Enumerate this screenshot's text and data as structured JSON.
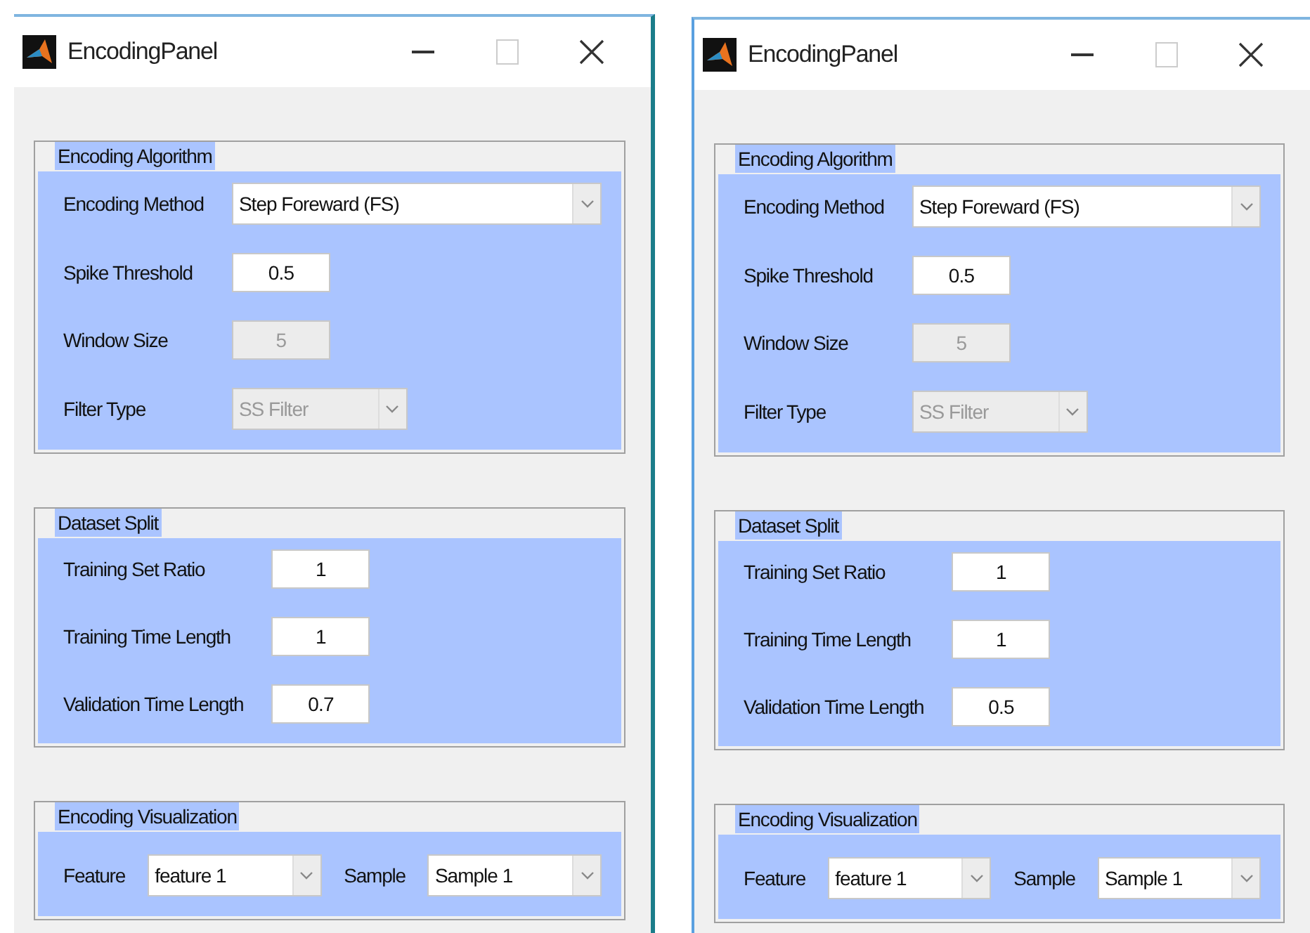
{
  "windows": [
    {
      "title": "EncodingPanel",
      "panels": [
        {
          "title": "Encoding Algorithm",
          "inline": false,
          "rows": [
            {
              "kind": "select",
              "label": "Encoding Method",
              "value": "Step Foreward (FS)",
              "disabled": false
            },
            {
              "kind": "field",
              "label": "Spike Threshold",
              "value": "0.5",
              "disabled": false
            },
            {
              "kind": "field",
              "label": "Window Size",
              "value": "5",
              "disabled": true
            },
            {
              "kind": "select",
              "label": "Filter Type",
              "value": "SS Filter",
              "disabled": true
            }
          ]
        },
        {
          "title": "Dataset Split",
          "inline": false,
          "rows": [
            {
              "kind": "field",
              "label": "Training Set Ratio",
              "value": "1",
              "disabled": false
            },
            {
              "kind": "field",
              "label": "Training Time Length",
              "value": "1",
              "disabled": false
            },
            {
              "kind": "field",
              "label": "Validation Time Length",
              "value": "0.7",
              "disabled": false
            }
          ]
        },
        {
          "title": "Encoding Visualization",
          "inline": true,
          "rows": [
            {
              "kind": "select",
              "label": "Feature",
              "value": "feature 1",
              "disabled": false
            },
            {
              "kind": "select",
              "label": "Sample",
              "value": "Sample 1",
              "disabled": false
            }
          ]
        }
      ]
    },
    {
      "title": "EncodingPanel",
      "panels": [
        {
          "title": "Encoding Algorithm",
          "inline": false,
          "rows": [
            {
              "kind": "select",
              "label": "Encoding Method",
              "value": "Step Foreward (FS)",
              "disabled": false
            },
            {
              "kind": "field",
              "label": "Spike Threshold",
              "value": "0.5",
              "disabled": false
            },
            {
              "kind": "field",
              "label": "Window Size",
              "value": "5",
              "disabled": true
            },
            {
              "kind": "select",
              "label": "Filter Type",
              "value": "SS Filter",
              "disabled": true
            }
          ]
        },
        {
          "title": "Dataset Split",
          "inline": false,
          "rows": [
            {
              "kind": "field",
              "label": "Training Set Ratio",
              "value": "1",
              "disabled": false
            },
            {
              "kind": "field",
              "label": "Training Time Length",
              "value": "1",
              "disabled": false
            },
            {
              "kind": "field",
              "label": "Validation Time Length",
              "value": "0.5",
              "disabled": false
            }
          ]
        },
        {
          "title": "Encoding Visualization",
          "inline": true,
          "rows": [
            {
              "kind": "select",
              "label": "Feature",
              "value": "feature 1",
              "disabled": false
            },
            {
              "kind": "select",
              "label": "Sample",
              "value": "Sample 1",
              "disabled": false
            }
          ]
        }
      ]
    }
  ]
}
